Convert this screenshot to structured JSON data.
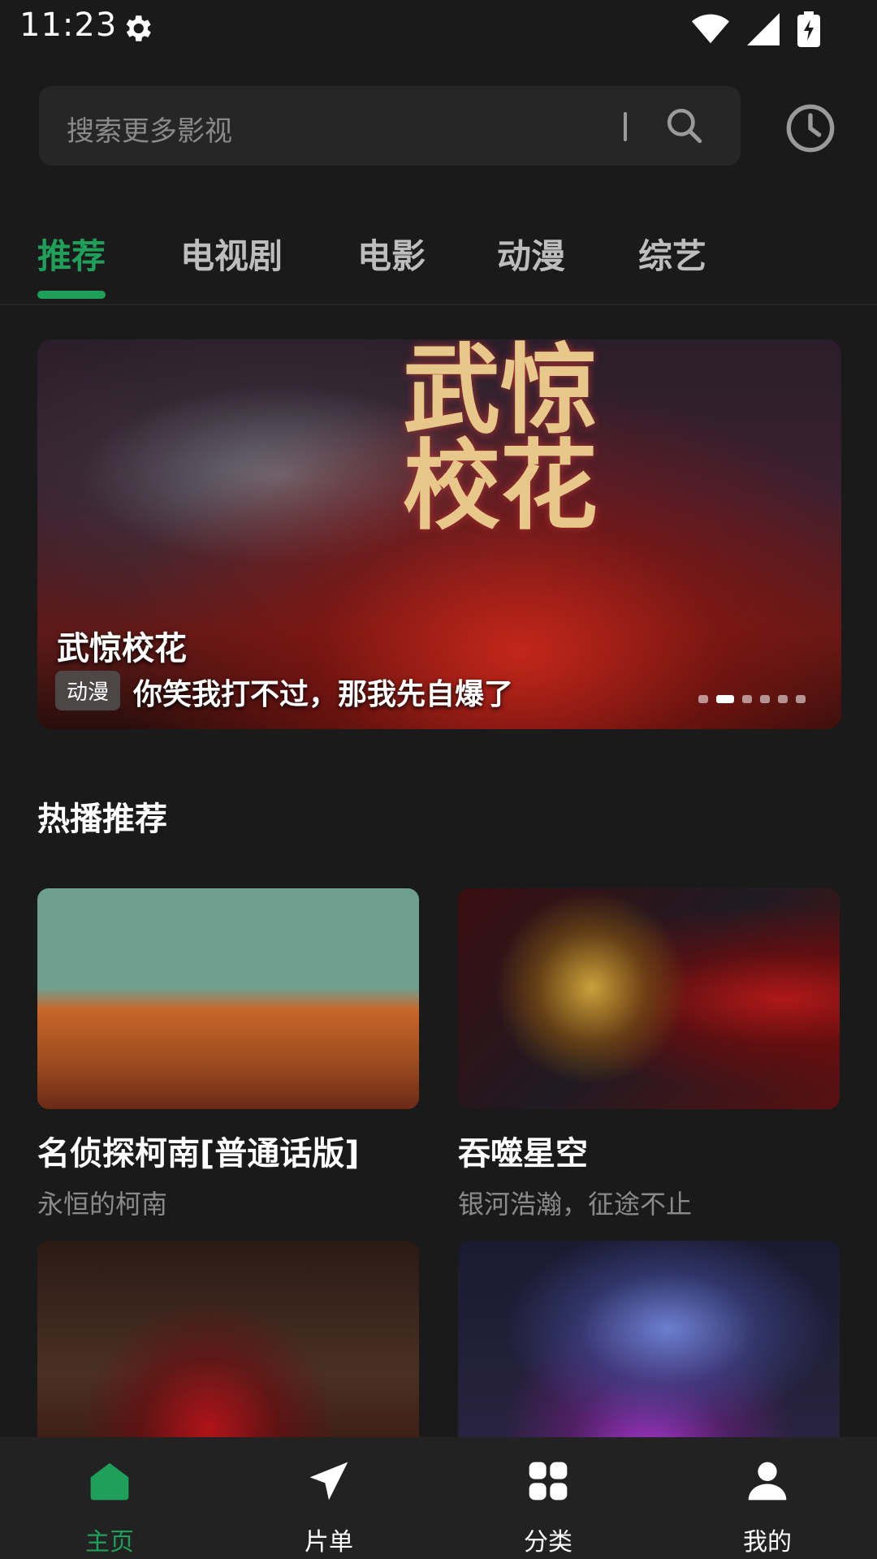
{
  "status_bar": {
    "time": "11:23"
  },
  "search": {
    "placeholder": "搜索更多影视"
  },
  "tabs": [
    {
      "label": "推荐",
      "active": true
    },
    {
      "label": "电视剧",
      "active": false
    },
    {
      "label": "电影",
      "active": false
    },
    {
      "label": "动漫",
      "active": false
    },
    {
      "label": "综艺",
      "active": false
    }
  ],
  "banner": {
    "art_text": "武惊校花",
    "title": "武惊校花",
    "badge": "动漫",
    "subtitle": "你笑我打不过，那我先自爆了",
    "page_count": 6,
    "active_page": 2
  },
  "section": {
    "title": "热播推荐"
  },
  "cards": [
    {
      "title": "名侦探柯南[普通话版]",
      "subtitle": "永恒的柯南"
    },
    {
      "title": "吞噬星空",
      "subtitle": "银河浩瀚，征途不止"
    },
    {
      "title": "",
      "subtitle": ""
    },
    {
      "title": "",
      "subtitle": ""
    }
  ],
  "bottom_nav": [
    {
      "label": "主页",
      "icon": "home-icon",
      "active": true
    },
    {
      "label": "片单",
      "icon": "paper-plane-icon",
      "active": false
    },
    {
      "label": "分类",
      "icon": "grid-icon",
      "active": false
    },
    {
      "label": "我的",
      "icon": "person-icon",
      "active": false
    }
  ],
  "colors": {
    "accent": "#1fa05a",
    "background": "#1a1a1a",
    "muted_text": "#8a8a8a"
  }
}
